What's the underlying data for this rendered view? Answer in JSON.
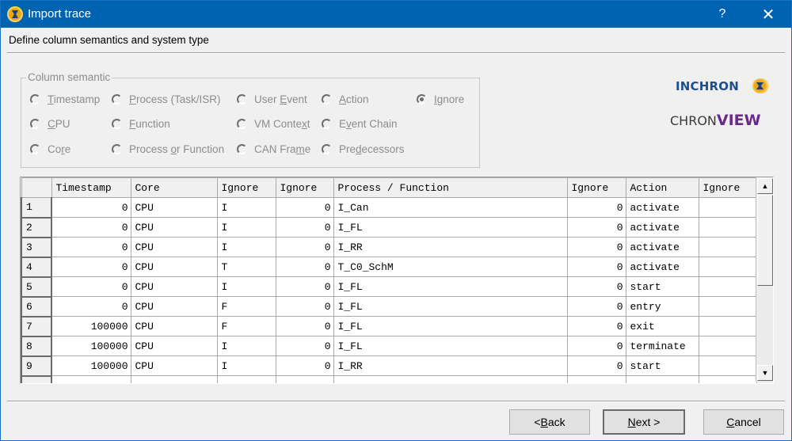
{
  "window": {
    "title": "Import trace",
    "help_label": "?",
    "close_label": "✕",
    "subtitle": "Define column semantics and system type"
  },
  "column_semantic": {
    "legend": "Column semantic",
    "selected": "Ignore",
    "options": [
      {
        "label": "Timestamp",
        "pre": "",
        "ul": "T",
        "post": "imestamp",
        "checked": false
      },
      {
        "label": "Process (Task/ISR)",
        "pre": "",
        "ul": "P",
        "post": "rocess (Task/ISR)",
        "checked": false
      },
      {
        "label": "User Event",
        "pre": "User ",
        "ul": "E",
        "post": "vent",
        "checked": false
      },
      {
        "label": "Action",
        "pre": "",
        "ul": "A",
        "post": "ction",
        "checked": false
      },
      {
        "label": "Ignore",
        "pre": "",
        "ul": "I",
        "post": "gnore",
        "checked": true
      },
      {
        "label": "CPU",
        "pre": "",
        "ul": "C",
        "post": "PU",
        "checked": false
      },
      {
        "label": "Function",
        "pre": "",
        "ul": "F",
        "post": "unction",
        "checked": false
      },
      {
        "label": "VM Context",
        "pre": "VM Conte",
        "ul": "x",
        "post": "t",
        "checked": false
      },
      {
        "label": "Event Chain",
        "pre": "E",
        "ul": "v",
        "post": "ent Chain",
        "checked": false
      },
      {
        "label": "Core",
        "pre": "Co",
        "ul": "r",
        "post": "e",
        "checked": false
      },
      {
        "label": "Process or Function",
        "pre": "Process ",
        "ul": "o",
        "post": "r Function",
        "checked": false
      },
      {
        "label": "CAN Frame",
        "pre": "CAN Fra",
        "ul": "m",
        "post": "e",
        "checked": false
      },
      {
        "label": "Predecessors",
        "pre": "Pre",
        "ul": "d",
        "post": "ecessors",
        "checked": false
      }
    ]
  },
  "logos": {
    "inchron": "INCHRON",
    "chron": "CHRON",
    "view": "VIEW"
  },
  "grid": {
    "columns": [
      "Timestamp",
      "Core",
      "Ignore",
      "Ignore",
      "Process / Function",
      "Ignore",
      "Action",
      "Ignore"
    ],
    "rows": [
      {
        "n": "1",
        "cells": [
          "0",
          "CPU",
          "I",
          "0",
          "I_Can",
          "0",
          "activate",
          ""
        ]
      },
      {
        "n": "2",
        "cells": [
          "0",
          "CPU",
          "I",
          "0",
          "I_FL",
          "0",
          "activate",
          ""
        ]
      },
      {
        "n": "3",
        "cells": [
          "0",
          "CPU",
          "I",
          "0",
          "I_RR",
          "0",
          "activate",
          ""
        ]
      },
      {
        "n": "4",
        "cells": [
          "0",
          "CPU",
          "T",
          "0",
          "T_C0_SchM",
          "0",
          "activate",
          ""
        ]
      },
      {
        "n": "5",
        "cells": [
          "0",
          "CPU",
          "I",
          "0",
          "I_FL",
          "0",
          "start",
          ""
        ]
      },
      {
        "n": "6",
        "cells": [
          "0",
          "CPU",
          "F",
          "0",
          "I_FL",
          "0",
          "entry",
          ""
        ]
      },
      {
        "n": "7",
        "cells": [
          "100000",
          "CPU",
          "F",
          "0",
          "I_FL",
          "0",
          "exit",
          ""
        ]
      },
      {
        "n": "8",
        "cells": [
          "100000",
          "CPU",
          "I",
          "0",
          "I_FL",
          "0",
          "terminate",
          ""
        ]
      },
      {
        "n": "9",
        "cells": [
          "100000",
          "CPU",
          "I",
          "0",
          "I_RR",
          "0",
          "start",
          ""
        ]
      },
      {
        "n": "",
        "cells": [
          "",
          "",
          "",
          "",
          "",
          "",
          "",
          ""
        ]
      }
    ]
  },
  "buttons": {
    "back": {
      "pre": "< ",
      "ul": "B",
      "post": "ack"
    },
    "next": {
      "pre": "",
      "ul": "N",
      "post": "ext >"
    },
    "cancel": {
      "pre": "",
      "ul": "C",
      "post": "ancel"
    }
  }
}
